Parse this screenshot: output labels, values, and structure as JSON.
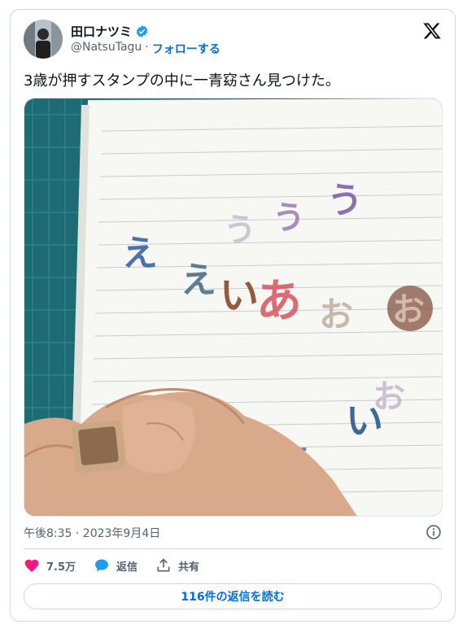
{
  "user": {
    "name": "田口ナツミ",
    "handle": "@NatsuTagu",
    "separator": "·",
    "follow_label": "フォローする"
  },
  "tweet": {
    "text": "3歳が押すスタンプの中に一青窈さん見つけた。",
    "timestamp": "午後8:35 · 2023年9月4日"
  },
  "actions": {
    "like_count": "7.5万",
    "reply_label": "返信",
    "share_label": "共有",
    "read_replies_label": "116件の返信を読む"
  },
  "colors": {
    "accent": "#1d9bf0",
    "like": "#f91880",
    "link": "#006fd6"
  },
  "icons": [
    "verified-badge-icon",
    "x-logo-icon",
    "info-icon",
    "heart-icon",
    "reply-bubble-icon",
    "share-icon"
  ]
}
